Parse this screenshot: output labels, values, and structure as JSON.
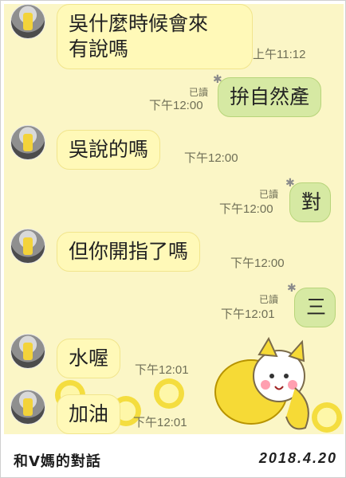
{
  "messages": [
    {
      "side": "in",
      "text": "吳什麼時候會來\n有說嗎",
      "time": "上午11:12"
    },
    {
      "side": "out",
      "text": "拚自然產",
      "read": "已讀",
      "time": "下午12:00"
    },
    {
      "side": "in",
      "text": "吳說的嗎",
      "time": "下午12:00"
    },
    {
      "side": "out",
      "text": "對",
      "read": "已讀",
      "time": "下午12:00"
    },
    {
      "side": "in",
      "text": "但你開指了嗎",
      "time": "下午12:00"
    },
    {
      "side": "out",
      "text": "三",
      "read": "已讀",
      "time": "下午12:01"
    },
    {
      "side": "in",
      "text": "水喔",
      "time": "下午12:01"
    },
    {
      "side": "in",
      "text": "加油",
      "time": "下午12:01"
    }
  ],
  "caption": {
    "left": "和V媽的對話",
    "right": "2018.4.20"
  }
}
